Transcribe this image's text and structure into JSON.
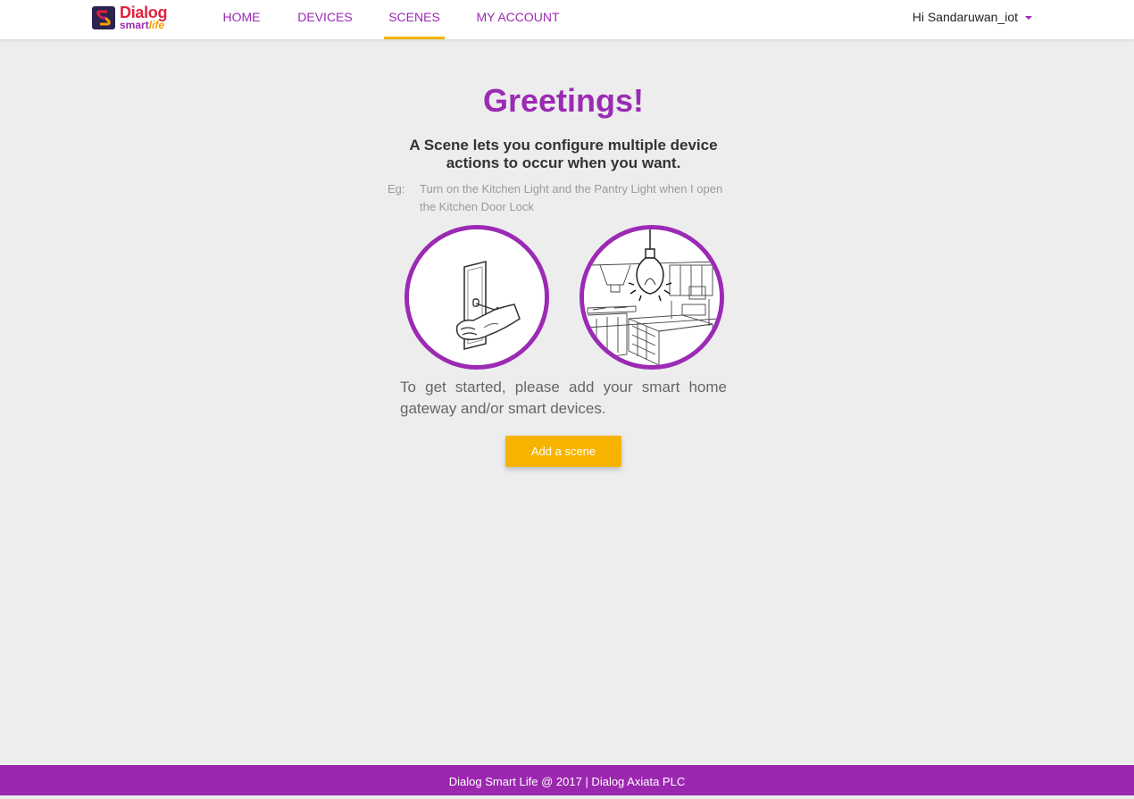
{
  "brand": {
    "name": "Dialog",
    "sub_smart": "smart",
    "sub_life": "life"
  },
  "nav": {
    "items": [
      {
        "label": "HOME"
      },
      {
        "label": "DEVICES"
      },
      {
        "label": "SCENES"
      },
      {
        "label": "MY ACCOUNT"
      }
    ],
    "active": "SCENES",
    "user_greeting": "Hi Sandaruwan_iot"
  },
  "main": {
    "title": "Greetings!",
    "subtitle": "A Scene lets you configure multiple device actions to occur when you want.",
    "example_label": "Eg:",
    "example_text": "Turn on the Kitchen Light and the Pantry Light when I open the Kitchen Door Lock",
    "instructions": "To get started, please add your smart home gateway and/or smart devices.",
    "add_button": "Add a scene"
  },
  "illustrations": [
    {
      "icon": "door-lock-hand-illustration"
    },
    {
      "icon": "kitchen-light-illustration"
    }
  ],
  "footer": {
    "text": "Dialog Smart Life @ 2017 | Dialog Axiata PLC"
  },
  "colors": {
    "primary": "#9b2ab4",
    "accent": "#f6b400",
    "background": "#ededed",
    "footer": "#9b27af"
  }
}
